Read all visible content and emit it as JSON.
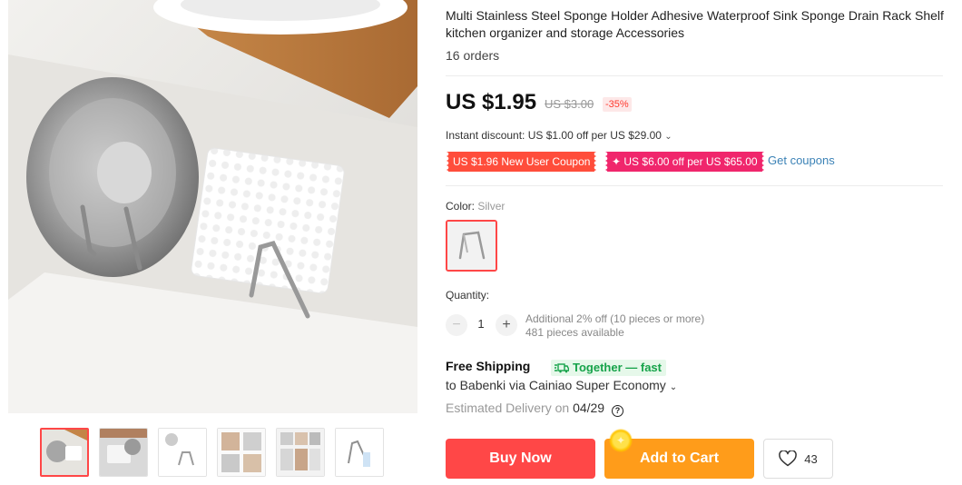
{
  "product": {
    "title": "Multi Stainless Steel Sponge Holder Adhesive Waterproof Sink Sponge Drain Rack Shelf kitchen organizer and storage Accessories",
    "orders": "16 orders"
  },
  "price": {
    "current": "US $1.95",
    "original": "US $3.00",
    "discount": "-35%"
  },
  "discount": {
    "instant": "Instant discount: US $1.00 off per US $29.00",
    "coupon_new_user": "US $1.96 New User Coupon",
    "coupon_store": "✦ US $6.00 off per US $65.00",
    "get_coupons": "Get coupons"
  },
  "color": {
    "label": "Color:",
    "selected": "Silver"
  },
  "quantity": {
    "label": "Quantity:",
    "minus": "−",
    "plus": "+",
    "value": "1",
    "note_line1": "Additional 2% off (10 pieces or more)",
    "note_line2": "481 pieces available"
  },
  "shipping": {
    "title": "Free Shipping",
    "badge": "Together — fast",
    "to": "to Babenki via Cainiao Super Economy",
    "eta_label": "Estimated Delivery on",
    "eta_date": "04/29",
    "help": "?"
  },
  "actions": {
    "buy_now": "Buy Now",
    "add_to_cart": "Add to Cart",
    "wishlist_count": "43"
  },
  "gallery": {
    "thumbnail_count": 6,
    "active_index": 0
  },
  "colors": {
    "accent_red": "#ff4747",
    "cart_orange": "#ff9c1a",
    "coupon_red": "#ff4d3b",
    "coupon_pink": "#f0266c",
    "link_blue": "#3b82b6",
    "shipping_green": "#16a34a"
  }
}
